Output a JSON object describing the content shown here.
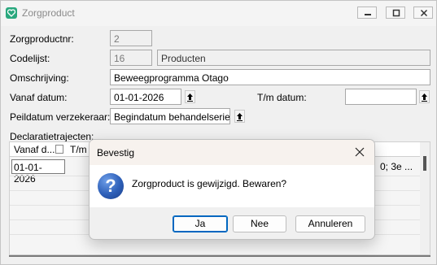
{
  "window": {
    "title": "Zorgproduct"
  },
  "form": {
    "zorgproductnr": {
      "label": "Zorgproductnr:",
      "value": "2"
    },
    "codelijst": {
      "label": "Codelijst:",
      "code": "16",
      "name": "Producten"
    },
    "omschrijving": {
      "label": "Omschrijving:",
      "value": "Beweegprogramma Otago"
    },
    "vanaf_datum": {
      "label": "Vanaf datum:",
      "value": "01-01-2026"
    },
    "tm_datum": {
      "label": "T/m datum:",
      "value": ""
    },
    "peildatum": {
      "label": "Peildatum verzekeraar:",
      "value": "Begindatum behandelserie"
    },
    "declaratietrajecten": {
      "label": "Declaratietrajecten:"
    }
  },
  "grid": {
    "columns": [
      "Vanaf d...",
      "T/m"
    ],
    "rows": [
      {
        "vanaf": "01-01-2026",
        "extra": "0; 3e ..."
      }
    ]
  },
  "dialog": {
    "title": "Bevestig",
    "message": "Zorgproduct is gewijzigd. Bewaren?",
    "buttons": {
      "ja": "Ja",
      "nee": "Nee",
      "annuleren": "Annuleren"
    }
  },
  "colors": {
    "app_icon": "#2aa87e",
    "default_button_border": "#0067c0"
  },
  "icons": {
    "app": "heart-check-icon",
    "question": "question-icon",
    "spin": "up-arrow-icon",
    "filter": "filter-icon"
  }
}
